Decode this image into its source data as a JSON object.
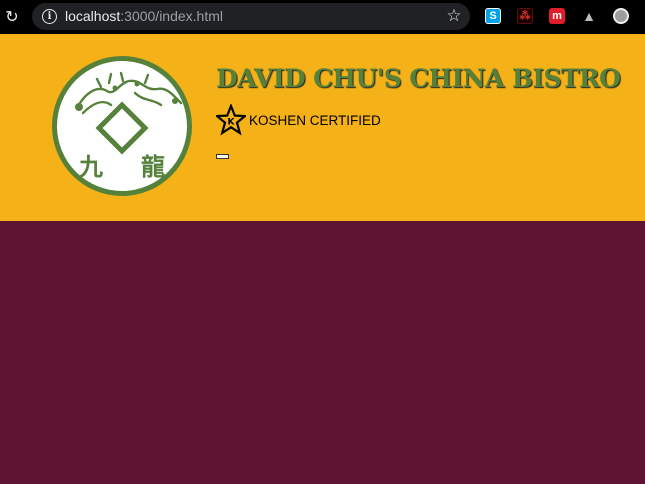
{
  "browser": {
    "url_host": "localhost",
    "url_path": ":3000/index.html",
    "reload_icon": "reload-icon",
    "info_icon": "info-icon",
    "bookmark_icon": "star-icon",
    "extensions": [
      "skype-icon",
      "pdf-icon",
      "m-icon",
      "drive-icon",
      "circle-icon"
    ]
  },
  "header": {
    "title": "DAVID CHU'S CHINA BISTRO",
    "award_text": "KOSHEN CERTIFIED",
    "logo_chars": [
      "九",
      "龍"
    ],
    "colors": {
      "header_bg": "#f5b118",
      "title": "#56813b",
      "page_bg": "#5f1332"
    }
  }
}
